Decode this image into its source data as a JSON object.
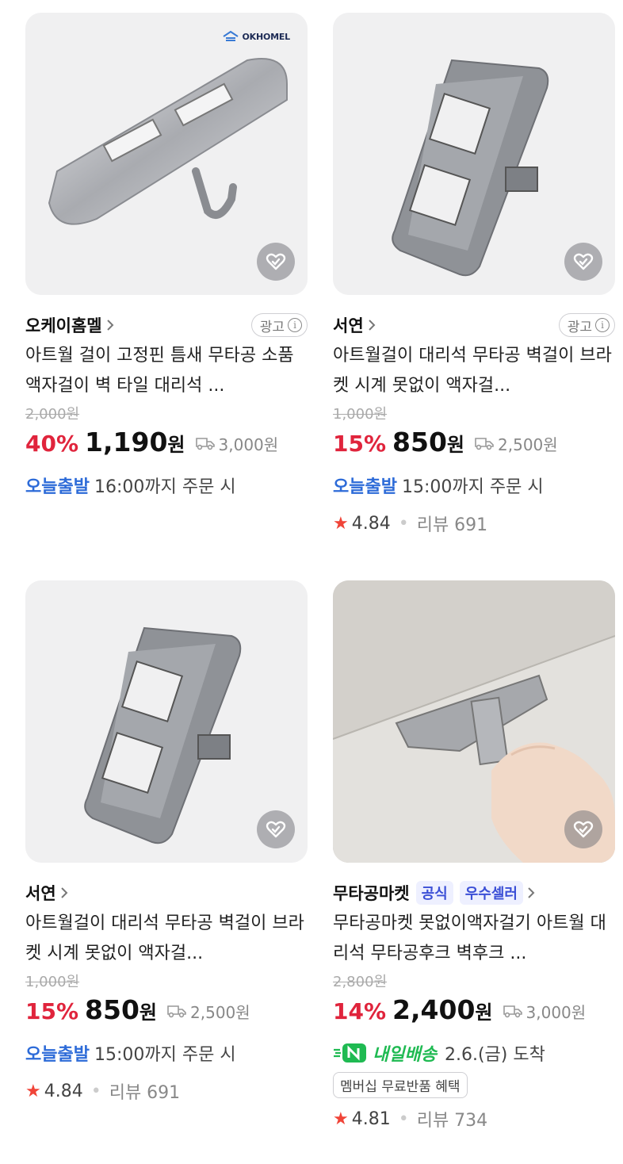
{
  "products": [
    {
      "seller": "오케이홈멜",
      "ad_label": "광고",
      "logo_text": "OKHOMEL",
      "title": "아트월 걸이 고정핀 틈새 무타공 소품 액자걸이 벽 타일 대리석 ...",
      "original_price": "2,000원",
      "discount": "40%",
      "price": "1,190",
      "won": "원",
      "shipping": "3,000원",
      "delivery_badge": "오늘출발",
      "delivery_text": "16:00까지 주문 시"
    },
    {
      "seller": "서연",
      "ad_label": "광고",
      "title": "아트월걸이 대리석 무타공 벽걸이 브라켓 시계 못없이 액자걸...",
      "original_price": "1,000원",
      "discount": "15%",
      "price": "850",
      "won": "원",
      "shipping": "2,500원",
      "delivery_badge": "오늘출발",
      "delivery_text": "15:00까지 주문 시",
      "rating": "4.84",
      "review": "리뷰 691"
    },
    {
      "seller": "서연",
      "title": "아트월걸이 대리석 무타공 벽걸이 브라켓 시계 못없이 액자걸...",
      "original_price": "1,000원",
      "discount": "15%",
      "price": "850",
      "won": "원",
      "shipping": "2,500원",
      "delivery_badge": "오늘출발",
      "delivery_text": "15:00까지 주문 시",
      "rating": "4.84",
      "review": "리뷰 691"
    },
    {
      "seller": "무타공마켓",
      "badges": [
        "공식",
        "우수셀러"
      ],
      "title": "무타공마켓 못없이액자걸기 아트월 대리석 무타공후크 벽후크 ...",
      "original_price": "2,800원",
      "discount": "14%",
      "price": "2,400",
      "won": "원",
      "shipping": "3,000원",
      "delivery_badge": "내일배송",
      "delivery_text": "2.6.(금) 도착",
      "benefit": "멤버십 무료반품 혜택",
      "rating": "4.81",
      "review": "리뷰 734"
    }
  ],
  "colors": {
    "discount": "#e0243c",
    "today": "#2d6bd8",
    "tomorrow": "#1fba52",
    "star": "#f04438"
  }
}
